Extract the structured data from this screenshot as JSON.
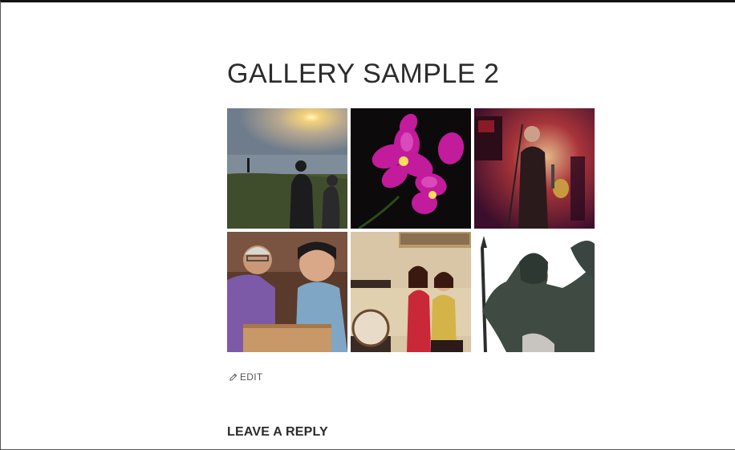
{
  "post": {
    "title": "GALLERY SAMPLE 2",
    "edit_label": "EDIT",
    "edit_icon": "pencil-icon"
  },
  "gallery": {
    "images": [
      {
        "name": "sunset-coast-photo"
      },
      {
        "name": "purple-orchid-photo"
      },
      {
        "name": "guitarist-stage-photo"
      },
      {
        "name": "elderly-couple-reading-photo"
      },
      {
        "name": "two-women-sofa-photo"
      },
      {
        "name": "bronze-statue-photo"
      }
    ]
  },
  "comments": {
    "heading": "LEAVE A REPLY"
  }
}
